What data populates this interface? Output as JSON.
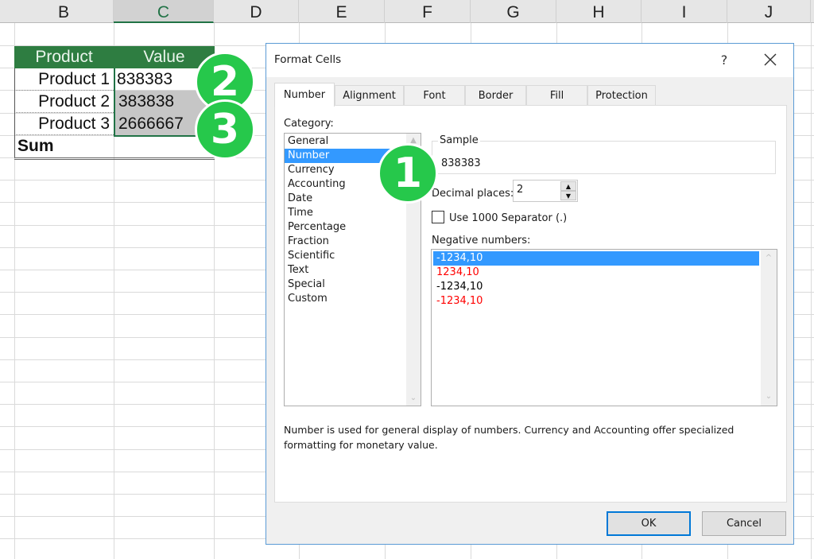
{
  "sheet": {
    "columns": [
      "B",
      "C",
      "D",
      "E",
      "F",
      "G",
      "H",
      "I",
      "J"
    ],
    "selected_column": "C",
    "table": {
      "headers": [
        "Product",
        "Value"
      ],
      "rows": [
        {
          "product": "Product 1",
          "value": "838383"
        },
        {
          "product": "Product 2",
          "value": "383838"
        },
        {
          "product": "Product 3",
          "value": "2666667"
        }
      ],
      "sum_label": "Sum",
      "sum_value": ""
    }
  },
  "badges": [
    "1",
    "2",
    "3"
  ],
  "dialog": {
    "title": "Format Cells",
    "help_label": "?",
    "tabs": [
      "Number",
      "Alignment",
      "Font",
      "Border",
      "Fill",
      "Protection"
    ],
    "active_tab": "Number",
    "category_label": "Category:",
    "categories": [
      "General",
      "Number",
      "Currency",
      "Accounting",
      "Date",
      "Time",
      "Percentage",
      "Fraction",
      "Scientific",
      "Text",
      "Special",
      "Custom"
    ],
    "selected_category": "Number",
    "sample_label": "Sample",
    "sample_value": "838383",
    "decimal_places_label": "Decimal places:",
    "decimal_places_value": "2",
    "separator_label": "Use 1000 Separator (.)",
    "separator_checked": false,
    "negative_numbers_label": "Negative numbers:",
    "negative_numbers": [
      {
        "text": "-1234,10",
        "color": "#000000",
        "selected": true
      },
      {
        "text": "1234,10",
        "color": "#ff0000",
        "selected": false
      },
      {
        "text": "-1234,10",
        "color": "#000000",
        "selected": false
      },
      {
        "text": "-1234,10",
        "color": "#ff0000",
        "selected": false
      }
    ],
    "description": "Number is used for general display of numbers.  Currency and Accounting offer specialized formatting for monetary value.",
    "ok_label": "OK",
    "cancel_label": "Cancel"
  },
  "colors": {
    "excel_green": "#217346",
    "table_header_green": "#2e7d41",
    "badge_green": "#26c84b",
    "selection_blue": "#3399ff",
    "negative_red": "#ff0000"
  }
}
